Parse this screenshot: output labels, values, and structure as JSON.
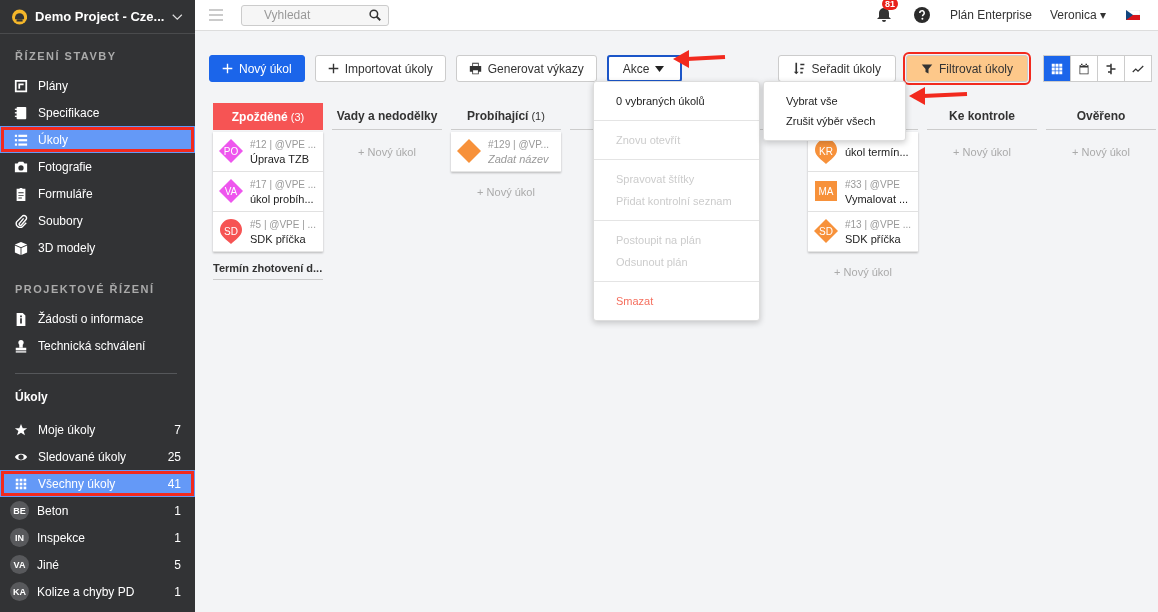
{
  "sidebar": {
    "project": "Demo Project - Cze...",
    "sections": [
      {
        "title": "ŘÍZENÍ STAVBY",
        "items": [
          {
            "kind": "plan",
            "label": "Plány",
            "selected": false,
            "highlighted": false
          },
          {
            "kind": "spec",
            "label": "Specifikace",
            "selected": false,
            "highlighted": false
          },
          {
            "kind": "list",
            "label": "Úkoly",
            "selected": true,
            "highlighted": true
          },
          {
            "kind": "camera",
            "label": "Fotografie",
            "selected": false,
            "highlighted": false
          },
          {
            "kind": "form",
            "label": "Formuláře",
            "selected": false,
            "highlighted": false
          },
          {
            "kind": "clip",
            "label": "Soubory",
            "selected": false,
            "highlighted": false
          },
          {
            "kind": "cube",
            "label": "3D modely",
            "selected": false,
            "highlighted": false
          }
        ]
      },
      {
        "title": "PROJEKTOVÉ ŘÍZENÍ",
        "items": [
          {
            "kind": "info",
            "label": "Žádosti o informace",
            "selected": false,
            "highlighted": false
          },
          {
            "kind": "stamp",
            "label": "Technická schválení",
            "selected": false,
            "highlighted": false
          }
        ]
      }
    ],
    "tasks_title": "Úkoly",
    "task_filters": [
      {
        "kind": "star",
        "label": "Moje úkoly",
        "count": "7",
        "selected": false,
        "highlighted": false
      },
      {
        "kind": "eye",
        "label": "Sledované úkoly",
        "count": "25",
        "selected": false,
        "highlighted": false
      },
      {
        "kind": "grid",
        "label": "Všechny úkoly",
        "count": "41",
        "selected": true,
        "highlighted": true
      },
      {
        "kind": "avatar",
        "initials": "BE",
        "label": "Beton",
        "count": "1",
        "selected": false,
        "highlighted": false
      },
      {
        "kind": "avatar",
        "initials": "IN",
        "label": "Inspekce",
        "count": "1",
        "selected": false,
        "highlighted": false
      },
      {
        "kind": "avatar",
        "initials": "VA",
        "label": "Jiné",
        "count": "5",
        "selected": false,
        "highlighted": false
      },
      {
        "kind": "avatar",
        "initials": "KA",
        "label": "Kolize a chyby PD",
        "count": "1",
        "selected": false,
        "highlighted": false
      }
    ]
  },
  "topbar": {
    "search": {
      "placeholder": "Vyhledat"
    },
    "notifications": "81",
    "plan": "Plán Enterprise",
    "user": "Veronica",
    "user_caret": "▾"
  },
  "toolbar": {
    "buttons": [
      {
        "kind": "primary",
        "label": "Nový úkol",
        "highlighted": false
      },
      {
        "kind": "import",
        "label": "Importovat úkoly",
        "highlighted": false
      },
      {
        "kind": "print",
        "label": "Generovat výkazy",
        "highlighted": false
      },
      {
        "kind": "dropdown",
        "label": "Akce",
        "highlighted": false
      }
    ],
    "right_buttons": [
      {
        "kind": "sort",
        "label": "Seřadit úkoly",
        "highlighted": false
      },
      {
        "kind": "filter",
        "label": "Filtrovat úkoly",
        "highlighted": true
      }
    ],
    "views": [
      {
        "kind": "grid",
        "selected": true
      },
      {
        "kind": "calendar",
        "selected": false
      },
      {
        "kind": "gantt",
        "selected": false
      },
      {
        "kind": "chart",
        "selected": false
      }
    ]
  },
  "board": {
    "columns": [
      {
        "title": "Zpožděné",
        "count": "(3)",
        "overdue": true,
        "cards": [
          {
            "kind": "diamond",
            "color": "#ee55ee",
            "initials": "PO",
            "meta": "#12 | @VPE ...",
            "name": "Úprava TZB",
            "placeholder": false
          },
          {
            "kind": "diamond",
            "color": "#ee55ee",
            "initials": "VA",
            "meta": "#17 | @VPE ...",
            "name": "úkol probíh...",
            "placeholder": false
          },
          {
            "kind": "pin",
            "color": "#f65454",
            "initials": "SD",
            "meta": "#5 | @VPE | ...",
            "name": "SDK příčka",
            "placeholder": false
          }
        ],
        "footer": "Termín zhotovení d..."
      },
      {
        "title": "Vady a nedodělky",
        "overdue": false,
        "new_task": "+ Nový úkol"
      },
      {
        "title": "Probíhající",
        "count": "(1)",
        "overdue": false,
        "cards": [
          {
            "kind": "diamond",
            "color": "#f7913a",
            "meta": "#129 | @VP...",
            "name": "Zadat název",
            "placeholder": true
          }
        ],
        "new_task": "+ Nový úkol"
      },
      {},
      {},
      {
        "cards": [
          {
            "kind": "pin",
            "color": "#f7913a",
            "initials": "KR",
            "name": "úkol termín...",
            "placeholder": false
          },
          {
            "kind": "square",
            "color": "#f7913a",
            "initials": "MA",
            "meta": "#33 | @VPE",
            "name": "Vymalovat ...",
            "placeholder": false
          },
          {
            "kind": "diamond",
            "color": "#f7913a",
            "initials": "SD",
            "meta": "#13 | @VPE ...",
            "name": "SDK příčka",
            "placeholder": false
          }
        ],
        "new_task": "+ Nový úkol"
      },
      {
        "title": "Ke kontrole",
        "overdue": false,
        "new_task": "+ Nový úkol"
      },
      {
        "title": "Ověřeno",
        "overdue": false,
        "new_task": "+ Nový úkol"
      }
    ]
  },
  "actions_menu": {
    "groups": [
      [
        {
          "label": "0 vybraných úkolů",
          "kind": "normal"
        }
      ],
      [
        {
          "label": "Znovu otevřít",
          "kind": "disabled"
        }
      ],
      [
        {
          "label": "Spravovat štítky",
          "kind": "disabled"
        },
        {
          "label": "Přidat kontrolní seznam",
          "kind": "disabled"
        }
      ],
      [
        {
          "label": "Postoupit na plán",
          "kind": "disabled"
        },
        {
          "label": "Odsunout plán",
          "kind": "disabled"
        }
      ],
      [
        {
          "label": "Smazat",
          "kind": "danger"
        }
      ]
    ]
  },
  "selection_menu": {
    "items": [
      "Vybrat vše",
      "Zrušit výběr všech"
    ]
  }
}
